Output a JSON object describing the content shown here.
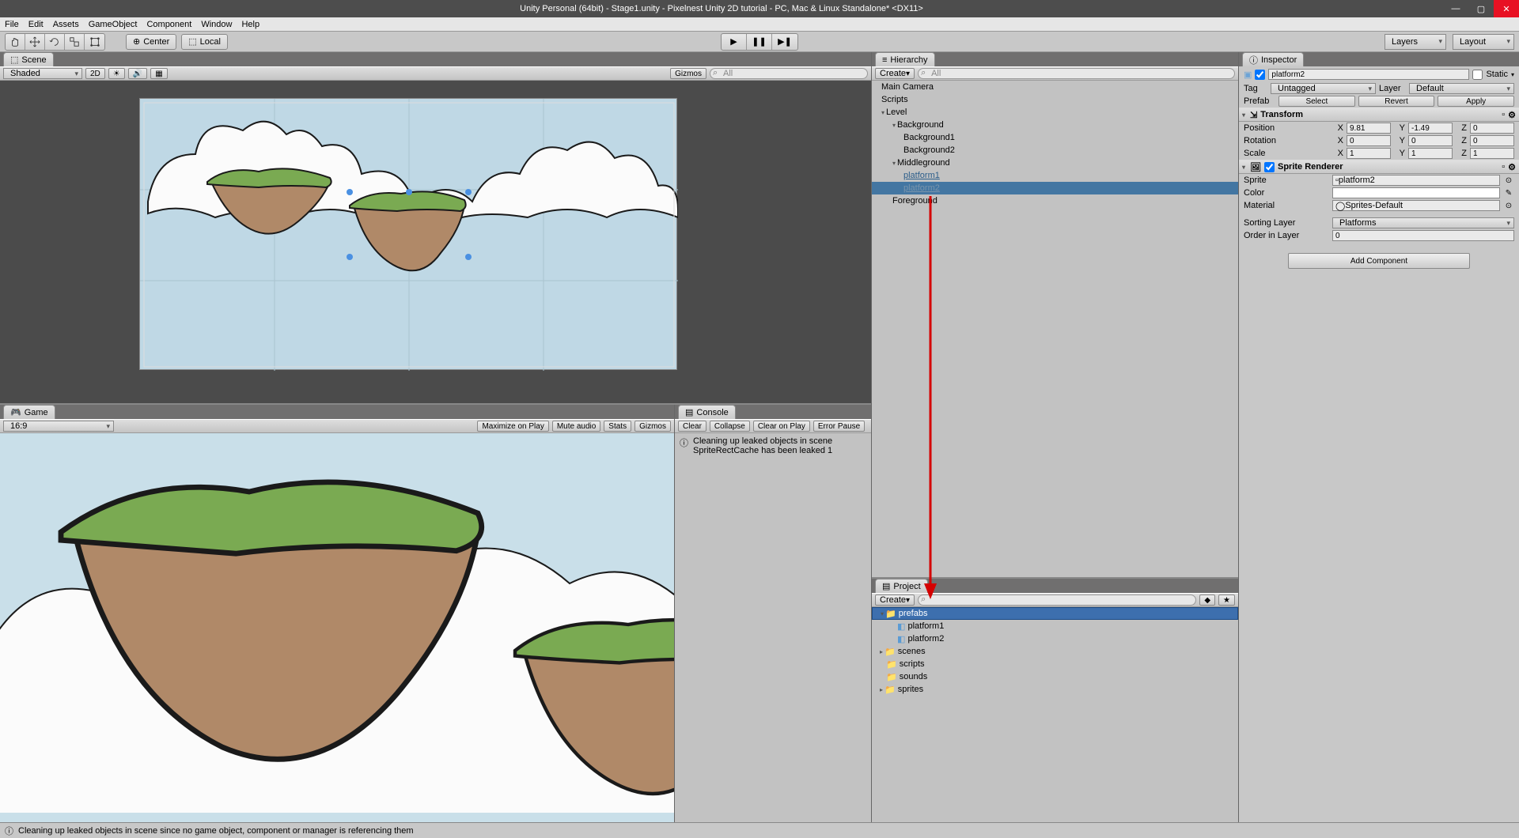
{
  "window": {
    "title": "Unity Personal (64bit) - Stage1.unity - Pixelnest Unity 2D tutorial - PC, Mac & Linux Standalone* <DX11>"
  },
  "menu": [
    "File",
    "Edit",
    "Assets",
    "GameObject",
    "Component",
    "Window",
    "Help"
  ],
  "toolbar": {
    "pivot_center": "Center",
    "pivot_local": "Local",
    "layers": "Layers",
    "layout": "Layout"
  },
  "scene": {
    "tab": "Scene",
    "shading": "Shaded",
    "mode2d": "2D",
    "gizmos": "Gizmos",
    "search_placeholder": "All"
  },
  "game": {
    "tab": "Game",
    "aspect": "16:9",
    "maximize": "Maximize on Play",
    "mute": "Mute audio",
    "stats": "Stats",
    "gizmos": "Gizmos"
  },
  "console": {
    "tab": "Console",
    "clear": "Clear",
    "collapse": "Collapse",
    "clear_on_play": "Clear on Play",
    "error_pause": "Error Pause",
    "msg1": "Cleaning up leaked objects in scene",
    "msg2": "SpriteRectCache has been leaked 1"
  },
  "hierarchy": {
    "tab": "Hierarchy",
    "create": "Create",
    "items": [
      "Main Camera",
      "Scripts",
      "Level",
      "Background",
      "Background1",
      "Background2",
      "Middleground",
      "platform1",
      "platform2",
      "Foreground"
    ]
  },
  "project": {
    "tab": "Project",
    "create": "Create",
    "folders": [
      "prefabs",
      "platform1",
      "platform2",
      "scenes",
      "scripts",
      "sounds",
      "sprites"
    ]
  },
  "inspector": {
    "tab": "Inspector",
    "name": "platform2",
    "static": "Static",
    "tag_label": "Tag",
    "tag_value": "Untagged",
    "layer_label": "Layer",
    "layer_value": "Default",
    "prefab_label": "Prefab",
    "select": "Select",
    "revert": "Revert",
    "apply": "Apply",
    "transform": {
      "title": "Transform",
      "position": "Position",
      "px": "9.81",
      "py": "-1.49",
      "pz": "0",
      "rotation": "Rotation",
      "rx": "0",
      "ry": "0",
      "rz": "0",
      "scale": "Scale",
      "sx": "1",
      "sy": "1",
      "sz": "1"
    },
    "sprite_renderer": {
      "title": "Sprite Renderer",
      "sprite_label": "Sprite",
      "sprite_value": "platform2",
      "color_label": "Color",
      "material_label": "Material",
      "material_value": "Sprites-Default",
      "sorting_label": "Sorting Layer",
      "sorting_value": "Platforms",
      "order_label": "Order in Layer",
      "order_value": "0"
    },
    "add_component": "Add Component"
  },
  "status": "Cleaning up leaked objects in scene since no game object, component or manager is referencing them"
}
